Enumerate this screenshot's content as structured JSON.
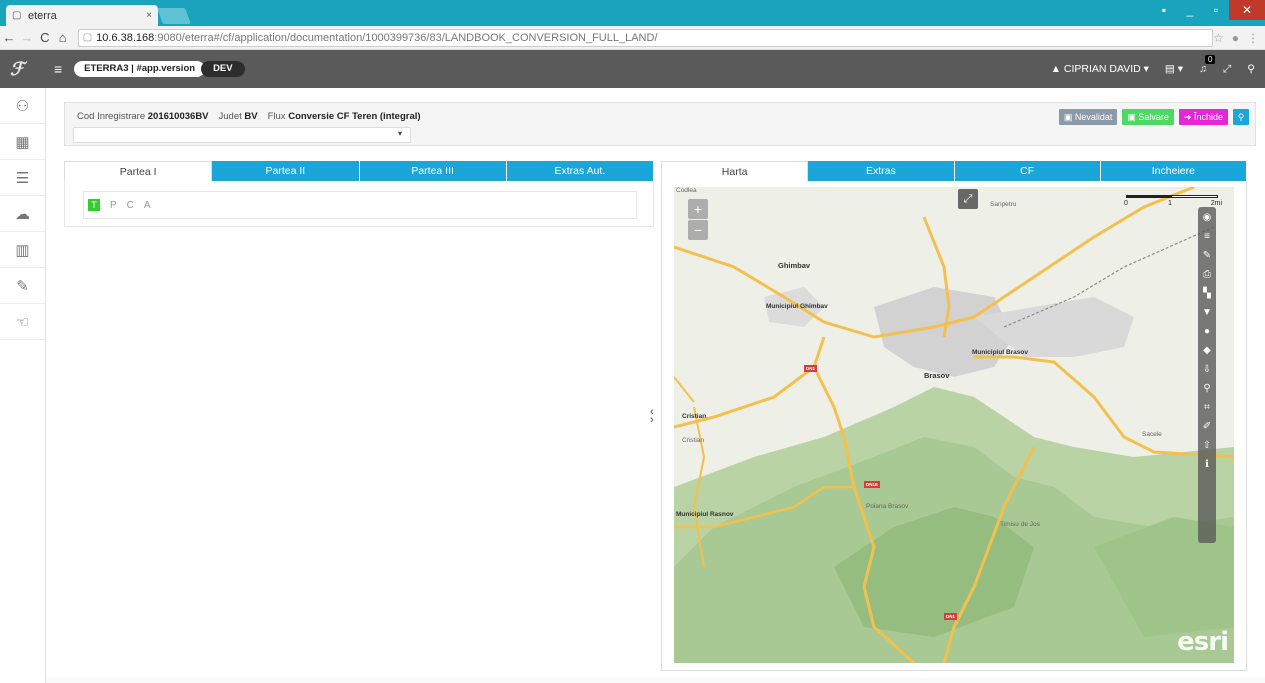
{
  "browser": {
    "tab_title": "eterra",
    "tab_close": "×",
    "url_host": "10.6.38.168",
    "url_path": ":9080/eterra#/cf/application/documentation/1000399736/83/LANDBOOK_CONVERSION_FULL_LAND/"
  },
  "header": {
    "version_pill": "ETERRA3 | #app.version",
    "env_pill": "DEV",
    "user": "CIPRIAN DAVID",
    "notif_count": "0"
  },
  "sidebar": {
    "items": [
      {
        "icon": "user-icon"
      },
      {
        "icon": "grid-icon"
      },
      {
        "icon": "list-icon"
      },
      {
        "icon": "cloud-icon"
      },
      {
        "icon": "book-icon"
      },
      {
        "icon": "edit-icon"
      },
      {
        "icon": "hand-icon"
      }
    ]
  },
  "info": {
    "cod_label": "Cod Inregistrare",
    "cod_value": "201610036BV",
    "judet_label": "Judet",
    "judet_value": "BV",
    "flux_label": "Flux",
    "flux_value": "Conversie CF Teren (integral)",
    "buttons": {
      "nevalidat": "Nevalidat",
      "salvare": "Salvare",
      "inchide": "Închide"
    }
  },
  "left_tabs": [
    "Partea I",
    "Partea II",
    "Partea III",
    "Extras Aut."
  ],
  "right_tabs": [
    "Harta",
    "Extras",
    "CF",
    "Incheiere"
  ],
  "tpca": [
    "T",
    "P",
    "C",
    "A"
  ],
  "map": {
    "scale_labels": [
      "0",
      "1",
      "2mi"
    ],
    "labels": [
      {
        "text": "Ghimbav"
      },
      {
        "text": "Municipiul Ghimbav"
      },
      {
        "text": "Municipiul Brasov"
      },
      {
        "text": "Brasov"
      },
      {
        "text": "Sanpetru"
      },
      {
        "text": "Cristian"
      },
      {
        "text": "Cristian"
      },
      {
        "text": "Poiana Brasov"
      },
      {
        "text": "Timisu de Jos"
      },
      {
        "text": "Municipiul Rasnov"
      },
      {
        "text": "Codlea"
      },
      {
        "text": "Sacele"
      }
    ],
    "shields": [
      "DN1",
      "DN1E",
      "DN1"
    ],
    "attribution": "esri"
  },
  "colors": {
    "accent": "#1aa6d8",
    "header_bg": "#5a5a5a",
    "browser_tab_bg": "#1aa3bd"
  }
}
